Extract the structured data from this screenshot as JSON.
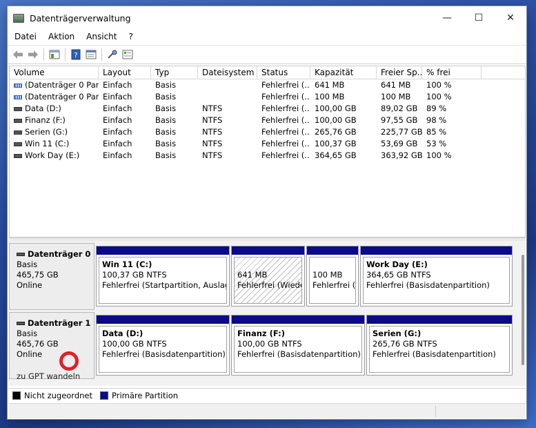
{
  "window": {
    "title": "Datenträgerverwaltung",
    "controls": {
      "minimize": "—",
      "maximize": "☐",
      "close": "✕"
    }
  },
  "menu": [
    "Datei",
    "Aktion",
    "Ansicht",
    "?"
  ],
  "toolbar": {
    "buttons": [
      "back-icon",
      "forward-icon",
      "console-tree-icon",
      "help-icon",
      "connect-icon",
      "properties-icon"
    ]
  },
  "volumes": {
    "columns": [
      "Volume",
      "Layout",
      "Typ",
      "Dateisystem",
      "Status",
      "Kapazität",
      "Freier Sp...",
      "% frei"
    ],
    "rows": [
      [
        "(Datenträger 0 Par...",
        "Einfach",
        "Basis",
        "",
        "Fehlerfrei (...",
        "641 MB",
        "641 MB",
        "100 %"
      ],
      [
        "(Datenträger 0 Par...",
        "Einfach",
        "Basis",
        "",
        "Fehlerfrei (...",
        "100 MB",
        "100 MB",
        "100 %"
      ],
      [
        "Data (D:)",
        "Einfach",
        "Basis",
        "NTFS",
        "Fehlerfrei (...",
        "100,00 GB",
        "89,02 GB",
        "89 %"
      ],
      [
        "Finanz (F:)",
        "Einfach",
        "Basis",
        "NTFS",
        "Fehlerfrei (...",
        "100,00 GB",
        "97,55 GB",
        "98 %"
      ],
      [
        "Serien (G:)",
        "Einfach",
        "Basis",
        "NTFS",
        "Fehlerfrei (...",
        "265,76 GB",
        "225,77 GB",
        "85 %"
      ],
      [
        "Win 11 (C:)",
        "Einfach",
        "Basis",
        "NTFS",
        "Fehlerfrei (...",
        "100,37 GB",
        "53,69 GB",
        "53 %"
      ],
      [
        "Work Day (E:)",
        "Einfach",
        "Basis",
        "NTFS",
        "Fehlerfrei (...",
        "364,65 GB",
        "363,92 GB",
        "100 %"
      ]
    ]
  },
  "disks": [
    {
      "name": "Datenträger 0",
      "type": "Basis",
      "size": "465,75 GB",
      "state": "Online",
      "partitions": [
        {
          "name": "Win 11  (C:)",
          "line1": "100,37 GB NTFS",
          "line2": "Fehlerfrei (Startpartition, Auslagerungsdatei"
        },
        {
          "name": "",
          "line1": "641 MB",
          "line2": "Fehlerfrei (Wiederherstellungspartition)"
        },
        {
          "name": "",
          "line1": "100 MB",
          "line2": "Fehlerfrei (EFI-Systempartition)"
        },
        {
          "name": "Work Day  (E:)",
          "line1": "364,65 GB NTFS",
          "line2": "Fehlerfrei (Basisdatenpartition)"
        }
      ]
    },
    {
      "name": "Datenträger 1",
      "type": "Basis",
      "size": "465,76 GB",
      "state": "Online",
      "annotation": "zu GPT wandeln",
      "partitions": [
        {
          "name": "Data  (D:)",
          "line1": "100,00 GB NTFS",
          "line2": "Fehlerfrei (Basisdatenpartition)"
        },
        {
          "name": "Finanz  (F:)",
          "line1": "100,00 GB NTFS",
          "line2": "Fehlerfrei (Basisdatenpartition)"
        },
        {
          "name": "Serien  (G:)",
          "line1": "265,76 GB NTFS",
          "line2": "Fehlerfrei (Basisdatenpartition)"
        }
      ]
    }
  ],
  "legend": {
    "items": [
      {
        "label": "Nicht zugeordnet",
        "color": "#000000"
      },
      {
        "label": "Primäre Partition",
        "color": "#0a0a8a"
      }
    ]
  },
  "colors": {
    "partition_bar": "#0a0a8a",
    "annotation_circle": "#e0202a"
  }
}
